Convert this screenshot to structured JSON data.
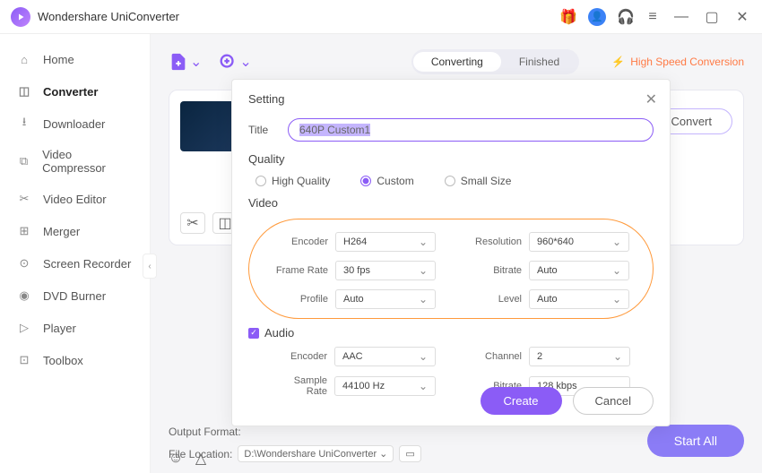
{
  "app": {
    "title": "Wondershare UniConverter"
  },
  "titlebar_icons": {
    "gift": "🎁",
    "avatar": "●",
    "support": "🎧",
    "menu": "≡"
  },
  "sidebar": {
    "items": [
      {
        "label": "Home",
        "icon": "home"
      },
      {
        "label": "Converter",
        "icon": "convert",
        "active": true
      },
      {
        "label": "Downloader",
        "icon": "download"
      },
      {
        "label": "Video Compressor",
        "icon": "compress"
      },
      {
        "label": "Video Editor",
        "icon": "edit"
      },
      {
        "label": "Merger",
        "icon": "merge"
      },
      {
        "label": "Screen Recorder",
        "icon": "record"
      },
      {
        "label": "DVD Burner",
        "icon": "dvd"
      },
      {
        "label": "Player",
        "icon": "play"
      },
      {
        "label": "Toolbox",
        "icon": "tools"
      }
    ]
  },
  "toolbar": {
    "tabs": [
      {
        "label": "Converting",
        "active": true
      },
      {
        "label": "Finished",
        "active": false
      }
    ],
    "high_speed": "High Speed Conversion"
  },
  "file_card": {
    "convert_btn": "Convert"
  },
  "bottom": {
    "output_format_label": "Output Format:",
    "file_location_label": "File Location:",
    "file_location_value": "D:\\Wondershare UniConverter",
    "start_all": "Start All"
  },
  "modal": {
    "heading": "Setting",
    "title_label": "Title",
    "title_value": "640P Custom1",
    "quality_heading": "Quality",
    "quality_options": [
      {
        "label": "High Quality",
        "selected": false
      },
      {
        "label": "Custom",
        "selected": true
      },
      {
        "label": "Small Size",
        "selected": false
      }
    ],
    "video_heading": "Video",
    "video_params": {
      "encoder": {
        "label": "Encoder",
        "value": "H264"
      },
      "resolution": {
        "label": "Resolution",
        "value": "960*640"
      },
      "framerate": {
        "label": "Frame Rate",
        "value": "30 fps"
      },
      "bitrate": {
        "label": "Bitrate",
        "value": "Auto"
      },
      "profile": {
        "label": "Profile",
        "value": "Auto"
      },
      "level": {
        "label": "Level",
        "value": "Auto"
      }
    },
    "audio_heading": "Audio",
    "audio_checked": true,
    "audio_params": {
      "encoder": {
        "label": "Encoder",
        "value": "AAC"
      },
      "channel": {
        "label": "Channel",
        "value": "2"
      },
      "samplerate": {
        "label": "Sample Rate",
        "value": "44100 Hz"
      },
      "bitrate": {
        "label": "Bitrate",
        "value": "128 kbps"
      }
    },
    "create_btn": "Create",
    "cancel_btn": "Cancel"
  }
}
